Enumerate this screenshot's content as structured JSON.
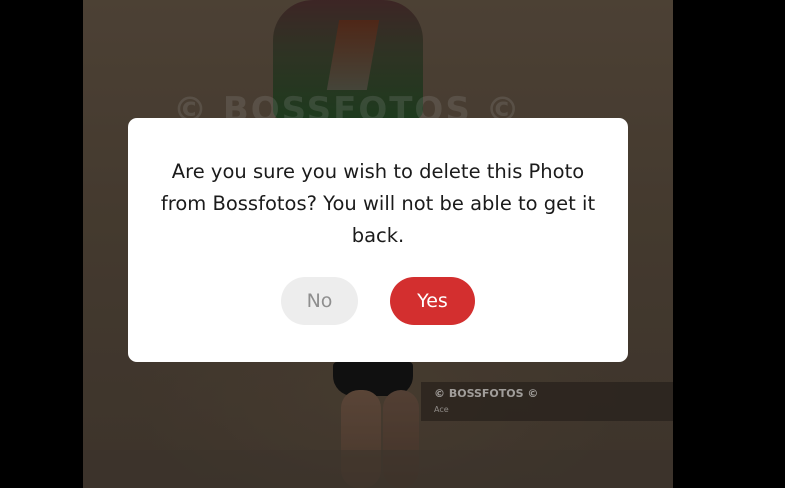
{
  "background": {
    "watermark": "© BOSSFOTOS ©",
    "caption": {
      "title": "© BOSSFOTOS ©",
      "subtitle": "Ace"
    }
  },
  "dialog": {
    "message": "Are you sure you wish to delete this Photo from Bossfotos? You will not be able to get it back.",
    "no_label": "No",
    "yes_label": "Yes"
  },
  "colors": {
    "yes_button": "#d32f2f",
    "no_button": "#ededed",
    "overlay": "#000000"
  }
}
